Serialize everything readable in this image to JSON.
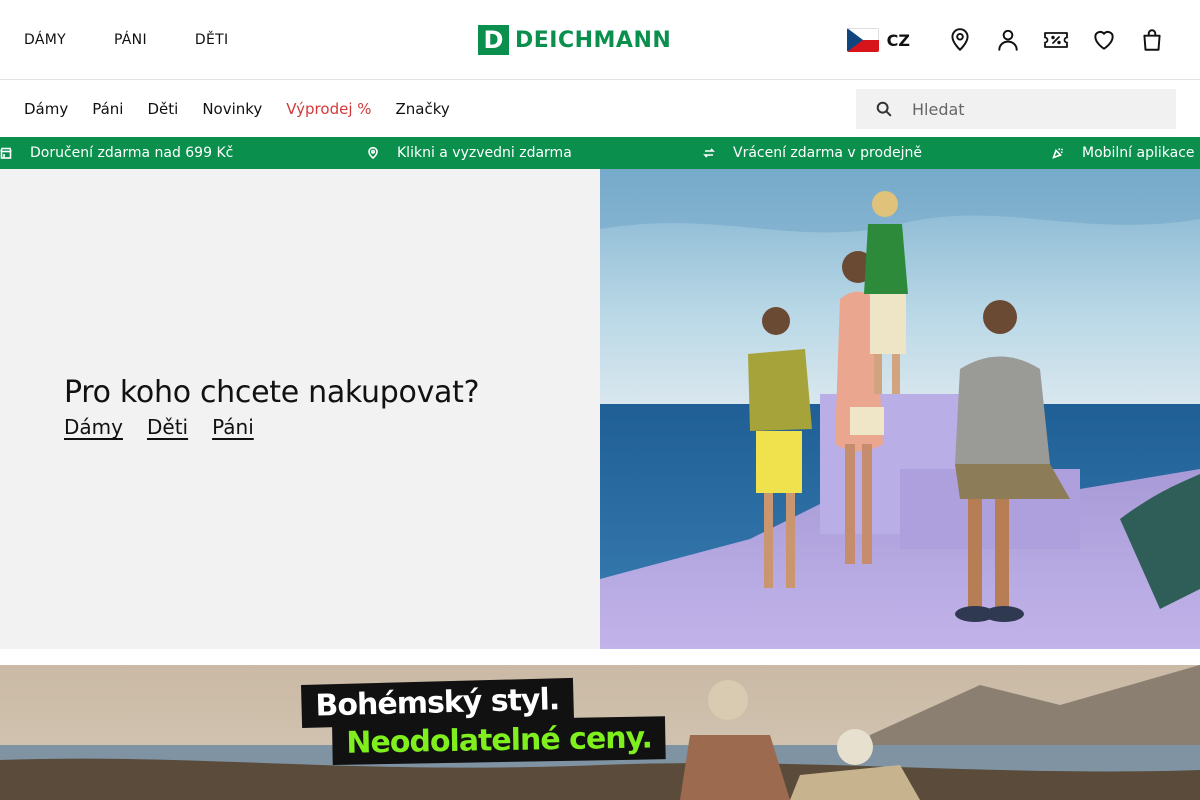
{
  "header": {
    "gender_nav": [
      "DÁMY",
      "PÁNI",
      "DĚTI"
    ],
    "logo_mark": "D",
    "logo_text": "DEICHMANN",
    "country_code": "CZ"
  },
  "icons": {
    "store_locator": "location-pin-icon",
    "account": "user-icon",
    "coupon": "discount-card-icon",
    "wishlist": "heart-icon",
    "cart": "shopping-bag-icon"
  },
  "category_nav": [
    {
      "label": "Dámy"
    },
    {
      "label": "Páni"
    },
    {
      "label": "Děti"
    },
    {
      "label": "Novinky"
    },
    {
      "label": "Výprodej %"
    },
    {
      "label": "Značky"
    }
  ],
  "search": {
    "placeholder": "Hledat"
  },
  "benefits": [
    "Doručení zdarma nad 699 Kč",
    "Klikni a vyzvedni zdarma",
    "Vrácení zdarma v prodejně",
    "Mobilní aplikace"
  ],
  "hero": {
    "title": "Pro koho chcete nakupovat?",
    "links": [
      "Dámy",
      "Děti",
      "Páni"
    ]
  },
  "promo": {
    "line1": "Bohémský styl.",
    "line2": "Neodolatelné ceny."
  },
  "colors": {
    "brand_green": "#0a8f4c",
    "sale_red": "#d23a3a",
    "promo_lime": "#7ff01e"
  }
}
